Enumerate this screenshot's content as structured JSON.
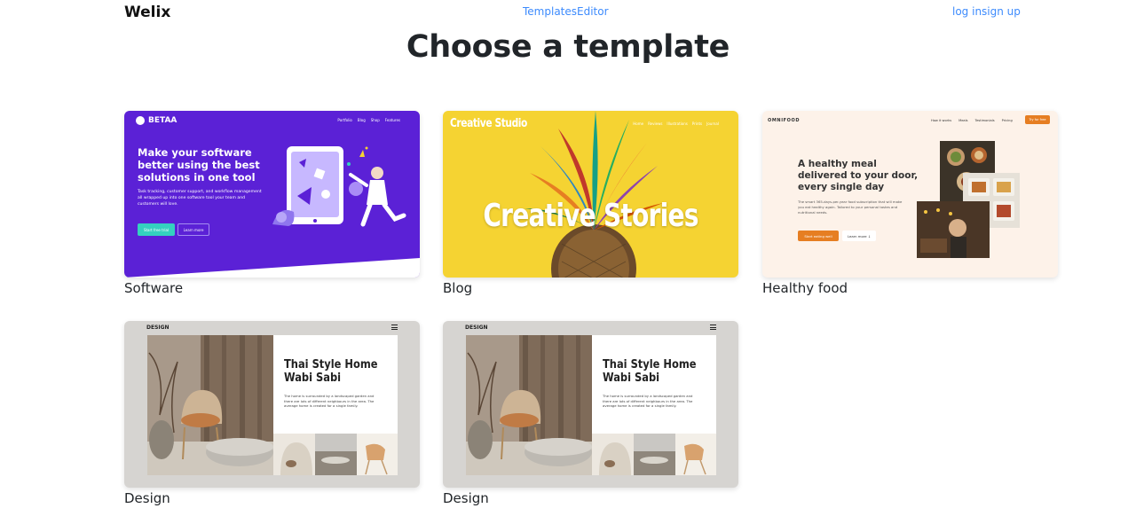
{
  "nav": {
    "brand": "Welix",
    "center_links": [
      "Templates",
      "Editor"
    ],
    "right_links": [
      "log in",
      "sign up"
    ]
  },
  "page_title": "Choose a template",
  "colors": {
    "link": "#3d8bfd",
    "software_bg": "#5b21d6",
    "blog_bg": "#f5d332",
    "food_bg": "#fdf2e9",
    "food_accent": "#e67e22",
    "design_bg": "#d6d4d1"
  },
  "templates": [
    {
      "label": "Software",
      "preview": {
        "logo": "BETAA",
        "menu": [
          "Portfolio",
          "Blog",
          "Shop",
          "Features"
        ],
        "headline": "Make your software better using the best solutions in one tool",
        "body": "Task tracking, customer support, and workflow management all wrapped up into one software tool your team and customers will love.",
        "primary_button": "Start free trial",
        "secondary_button": "Learn more"
      }
    },
    {
      "label": "Blog",
      "preview": {
        "logo": "Creative Studio",
        "menu": [
          "Home",
          "Reviews",
          "Illustrations",
          "Prints",
          "Journal"
        ],
        "headline": "Creative Stories"
      }
    },
    {
      "label": "Healthy food",
      "preview": {
        "logo": "OMNIFOOD",
        "menu": [
          "How it works",
          "Meals",
          "Testimonials",
          "Pricing"
        ],
        "cta": "Try for free",
        "headline": "A healthy meal delivered to your door, every single day",
        "body": "The smart 365-days-per-year food subscription that will make you eat healthy again. Tailored to your personal tastes and nutritional needs.",
        "primary_button": "Start eating well",
        "secondary_button": "Learn more ↓"
      }
    },
    {
      "label": "Design",
      "preview": {
        "logo": "DESIGN",
        "headline": "Thai Style Home Wabi Sabi",
        "body": "The home is surrounded by a landscaped garden and there are lots of different neighbours in the area. The average home is created for a single family."
      }
    },
    {
      "label": "Design",
      "preview": {
        "logo": "DESIGN",
        "headline": "Thai Style Home Wabi Sabi",
        "body": "The home is surrounded by a landscaped garden and there are lots of different neighbours in the area. The average home is created for a single family."
      }
    }
  ]
}
